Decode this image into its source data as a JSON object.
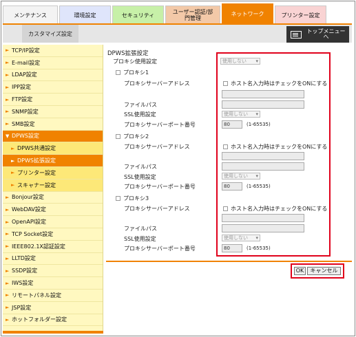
{
  "tabs": [
    {
      "label": "メンテナンス",
      "color": "#f3f3f3"
    },
    {
      "label": "環境設定",
      "color": "#dfe5fb"
    },
    {
      "label": "セキュリティ",
      "color": "#c7f0a8"
    },
    {
      "label": "ユーザー認証/部門管理",
      "color": "#f3c9a8"
    },
    {
      "label": "ネットワーク",
      "color": "#f08200"
    },
    {
      "label": "プリンター設定",
      "color": "#f9d3d3"
    }
  ],
  "subtab": {
    "label": "カスタマイズ設定"
  },
  "topmenu": {
    "label": "トップメニューへ"
  },
  "sidebar": {
    "items": [
      {
        "label": "TCP/IP設定"
      },
      {
        "label": "E-mail設定"
      },
      {
        "label": "LDAP設定"
      },
      {
        "label": "IPP設定"
      },
      {
        "label": "FTP設定"
      },
      {
        "label": "SNMP設定"
      },
      {
        "label": "SMB設定"
      },
      {
        "label": "DPWS設定"
      },
      {
        "label": "DPWS共通設定"
      },
      {
        "label": "DPWS拡張設定"
      },
      {
        "label": "プリンター設定"
      },
      {
        "label": "スキャナー設定"
      },
      {
        "label": "Bonjour設定"
      },
      {
        "label": "WebDAV設定"
      },
      {
        "label": "OpenAPI設定"
      },
      {
        "label": "TCP Socket設定"
      },
      {
        "label": "IEEE802.1X認証設定"
      },
      {
        "label": "LLTD設定"
      },
      {
        "label": "SSDP設定"
      },
      {
        "label": "IWS設定"
      },
      {
        "label": "リモートパネル設定"
      },
      {
        "label": "JSP設定"
      },
      {
        "label": "ホットフォルダー設定"
      }
    ]
  },
  "main": {
    "title": "DPWS拡張設定",
    "proxy_use_label": "プロキシ使用設定",
    "proxy_use_value": "使用しない",
    "proxies": [
      {
        "name": "プロキシ1",
        "address_label": "プロキシサーバーアドレス",
        "host_check_label": "ホスト名入力時はチェックをONにする",
        "filepath_label": "ファイルパス",
        "ssl_label": "SSL使用設定",
        "ssl_value": "使用しない",
        "port_label": "プロキシサーバーポート番号",
        "port_value": "80",
        "port_range": "(1-65535)"
      },
      {
        "name": "プロキシ2",
        "address_label": "プロキシサーバーアドレス",
        "host_check_label": "ホスト名入力時はチェックをONにする",
        "filepath_label": "ファイルパス",
        "ssl_label": "SSL使用設定",
        "ssl_value": "使用しない",
        "port_label": "プロキシサーバーポート番号",
        "port_value": "80",
        "port_range": "(1-65535)"
      },
      {
        "name": "プロキシ3",
        "address_label": "プロキシサーバーアドレス",
        "host_check_label": "ホスト名入力時はチェックをONにする",
        "filepath_label": "ファイルパス",
        "ssl_label": "SSL使用設定",
        "ssl_value": "使用しない",
        "port_label": "プロキシサーバーポート番号",
        "port_value": "80",
        "port_range": "(1-65535)"
      }
    ],
    "ok_label": "OK",
    "cancel_label": "キャンセル"
  },
  "colors": {
    "accent": "#f08200",
    "sidebar_bg": "#fff8c0",
    "highlight": "#e0001a"
  }
}
